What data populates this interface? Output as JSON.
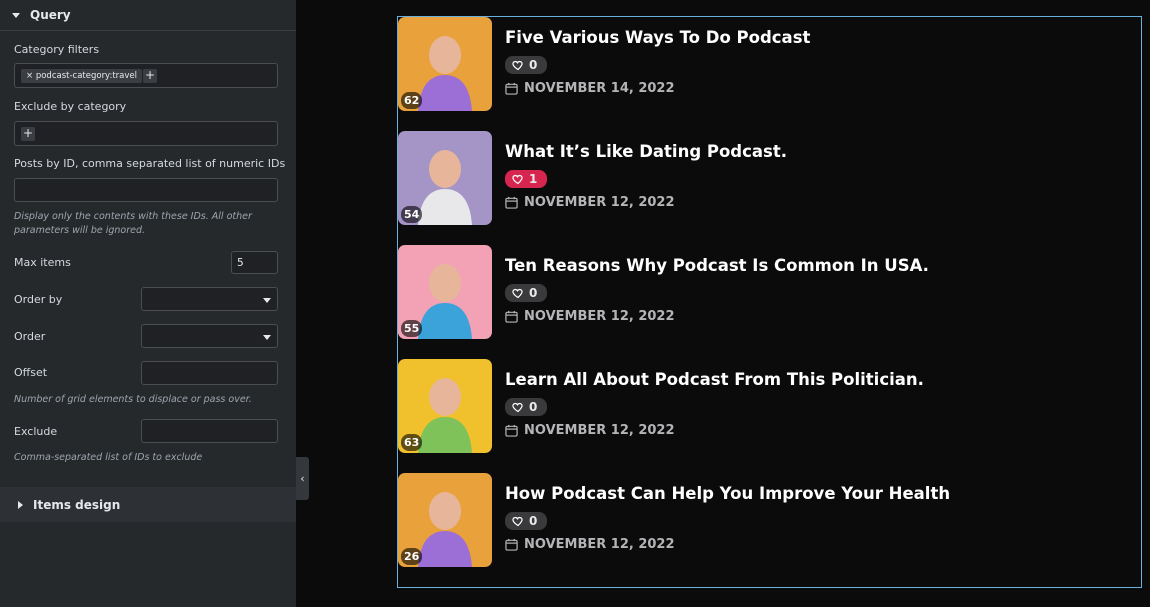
{
  "sidebar": {
    "query_section_title": "Query",
    "category_filters_label": "Category filters",
    "category_filter_tag": "× podcast-category:travel",
    "add_symbol": "+",
    "exclude_category_label": "Exclude by category",
    "posts_by_id_label": "Posts by ID, comma separated list of numeric IDs",
    "posts_by_id_value": "",
    "posts_by_id_note": "Display only the contents with these IDs. All other parameters will be ignored.",
    "max_items_label": "Max items",
    "max_items_value": "5",
    "order_by_label": "Order by",
    "order_label": "Order",
    "offset_label": "Offset",
    "offset_value": "",
    "offset_note": "Number of grid elements to displace or pass over.",
    "exclude_label": "Exclude",
    "exclude_value": "",
    "exclude_note": "Comma-separated list of IDs to exclude",
    "items_design_title": "Items design",
    "collapse_symbol": "‹"
  },
  "posts": [
    {
      "title": "Five Various Ways To Do Podcast",
      "likes": "0",
      "liked": false,
      "date": "NOVEMBER 14, 2022",
      "count": "62",
      "thumb_bg": "#e9a23b",
      "figure": "#9b6fd6"
    },
    {
      "title": "What It’s Like Dating Podcast.",
      "likes": "1",
      "liked": true,
      "date": "NOVEMBER 12, 2022",
      "count": "54",
      "thumb_bg": "#a595c7",
      "figure": "#e8e8ea"
    },
    {
      "title": "Ten Reasons Why Podcast Is Common In USA.",
      "likes": "0",
      "liked": false,
      "date": "NOVEMBER 12, 2022",
      "count": "55",
      "thumb_bg": "#f2a2b4",
      "figure": "#3ba3d9"
    },
    {
      "title": "Learn All About Podcast From This Politician.",
      "likes": "0",
      "liked": false,
      "date": "NOVEMBER 12, 2022",
      "count": "63",
      "thumb_bg": "#f0c02d",
      "figure": "#7fc25a"
    },
    {
      "title": "How Podcast Can Help You Improve Your Health",
      "likes": "0",
      "liked": false,
      "date": "NOVEMBER 12, 2022",
      "count": "26",
      "thumb_bg": "#e9a23b",
      "figure": "#9b6fd6"
    }
  ],
  "colors": {
    "accent_like": "#d6254f",
    "preview_border": "#6ab0de"
  },
  "icons": [
    "heart-icon",
    "calendar-icon",
    "caret-down-icon",
    "caret-right-icon",
    "chevron-left-icon"
  ]
}
